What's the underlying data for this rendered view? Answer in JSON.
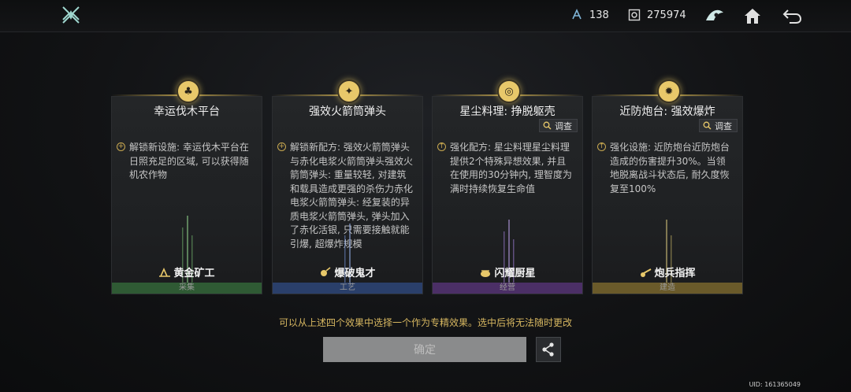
{
  "header": {
    "currency_a": "138",
    "currency_b": "275974"
  },
  "cards": [
    {
      "title": "幸运伐木平台",
      "description": "解锁新设施: 幸运伐木平台在日照充足的区域, 可以获得随机农作物",
      "skill": "黄金矿工",
      "category": "采集",
      "category_color": "#2f5a34"
    },
    {
      "title": "强效火箭筒弹头",
      "description": "解锁新配方: 强效火箭筒弹头与赤化电浆火箭筒弹头强效火箭筒弹头: 重量较轻, 对建筑和载具造成更强的杀伤力赤化电浆火箭筒弹头: 经复装的异质电浆火箭筒弹头, 弹头加入了赤化活银, 只需要接触就能引爆, 超爆炸规模",
      "skill": "爆破鬼才",
      "category": "工艺",
      "category_color": "#2a3f6a"
    },
    {
      "title": "星尘料理: 挣脱躯壳",
      "investigate": "调查",
      "description": "强化配方: 星尘料理星尘料理提供2个特殊异想效果, 并且在使用的30分钟内, 理智度为满时持续恢复生命值",
      "skill": "闪耀厨星",
      "category": "经营",
      "category_color": "#4b2f66"
    },
    {
      "title": "近防炮台: 强效爆炸",
      "investigate": "调查",
      "description": "强化设施: 近防炮台近防炮台造成的伤害提升30%。当领地脱离战斗状态后, 耐久度恢复至100%",
      "skill": "炮兵指挥",
      "category": "建造",
      "category_color": "#6a5a2a"
    }
  ],
  "note": "可以从上述四个效果中选择一个作为专精效果。选中后将无法随时更改",
  "confirm_label": "确定",
  "uid": "UID: 161365049"
}
